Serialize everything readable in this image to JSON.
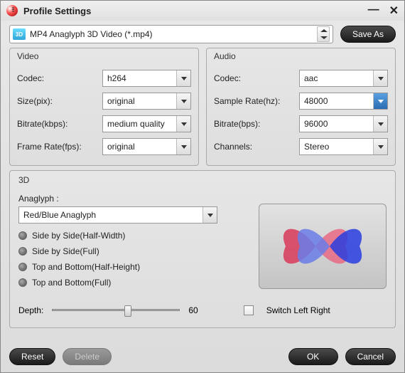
{
  "window": {
    "title": "Profile Settings"
  },
  "profile": {
    "selected": "MP4 Anaglyph 3D Video (*.mp4)",
    "save_as": "Save As"
  },
  "video": {
    "title": "Video",
    "codec_label": "Codec:",
    "codec": "h264",
    "size_label": "Size(pix):",
    "size": "original",
    "bitrate_label": "Bitrate(kbps):",
    "bitrate": "medium quality",
    "fps_label": "Frame Rate(fps):",
    "fps": "original"
  },
  "audio": {
    "title": "Audio",
    "codec_label": "Codec:",
    "codec": "aac",
    "sr_label": "Sample Rate(hz):",
    "sr": "48000",
    "bitrate_label": "Bitrate(bps):",
    "bitrate": "96000",
    "channels_label": "Channels:",
    "channels": "Stereo"
  },
  "threeD": {
    "title": "3D",
    "anaglyph_label": "Anaglyph :",
    "anaglyph": "Red/Blue Anaglyph",
    "options": {
      "sbs_half": "Side by Side(Half-Width)",
      "sbs_full": "Side by Side(Full)",
      "tab_half": "Top and Bottom(Half-Height)",
      "tab_full": "Top and Bottom(Full)"
    },
    "depth_label": "Depth:",
    "depth_value": "60",
    "depth_min": 0,
    "depth_max": 100,
    "switch_label": "Switch Left Right",
    "switch_checked": false
  },
  "footer": {
    "reset": "Reset",
    "delete": "Delete",
    "ok": "OK",
    "cancel": "Cancel"
  }
}
